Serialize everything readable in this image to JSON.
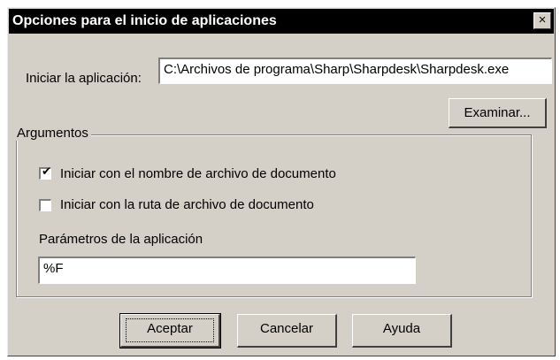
{
  "window": {
    "title": "Opciones para el inicio de aplicaciones",
    "close_glyph": "×"
  },
  "app_path": {
    "label": "Iniciar la aplicación:",
    "value": "C:\\Archivos de programa\\Sharp\\Sharpdesk\\Sharpdesk.exe"
  },
  "browse_button": "Examinar...",
  "arguments": {
    "title": "Argumentos",
    "checkbox_filename": {
      "label": "Iniciar con el nombre de archivo de documento",
      "checked": true
    },
    "checkbox_path": {
      "label": "Iniciar con la ruta de archivo de documento",
      "checked": false
    },
    "params_label": "Parámetros de la aplicación",
    "params_value": "%F"
  },
  "buttons": {
    "ok": "Aceptar",
    "cancel": "Cancelar",
    "help": "Ayuda"
  }
}
